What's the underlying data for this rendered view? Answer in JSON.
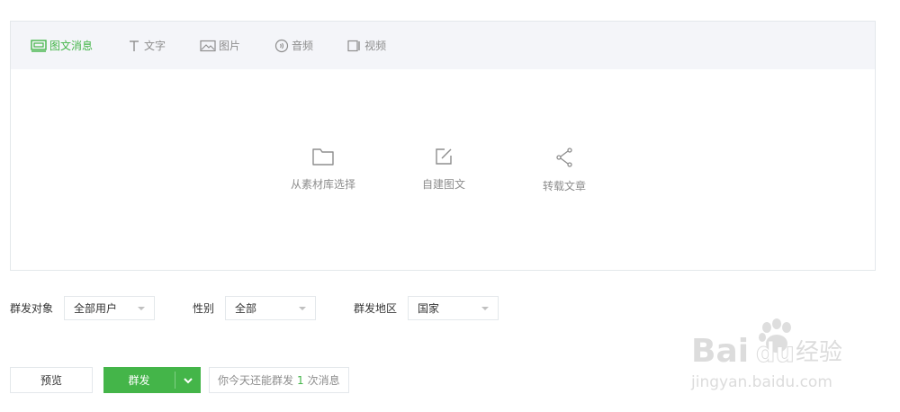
{
  "tabs": [
    {
      "label": "图文消息",
      "icon": "news-icon",
      "active": true
    },
    {
      "label": "文字",
      "icon": "text-icon",
      "active": false
    },
    {
      "label": "图片",
      "icon": "image-icon",
      "active": false
    },
    {
      "label": "音频",
      "icon": "audio-icon",
      "active": false
    },
    {
      "label": "视频",
      "icon": "video-icon",
      "active": false
    }
  ],
  "actions": [
    {
      "label": "从素材库选择",
      "icon": "folder-icon"
    },
    {
      "label": "自建图文",
      "icon": "edit-icon"
    },
    {
      "label": "转载文章",
      "icon": "share-icon"
    }
  ],
  "filters": {
    "target_label": "群发对象",
    "target_value": "全部用户",
    "gender_label": "性别",
    "gender_value": "全部",
    "region_label": "群发地区",
    "region_value": "国家"
  },
  "buttons": {
    "preview": "预览",
    "send": "群发"
  },
  "quota": {
    "prefix": "你今天还能群发",
    "count": "1",
    "suffix": "次消息"
  },
  "watermark": {
    "brand": "Bai",
    "paw": "du",
    "suffix": "经验",
    "url": "jingyan.baidu.com"
  },
  "colors": {
    "accent": "#44b549",
    "muted": "#8d8d8d",
    "border": "#e4e8eb",
    "tabbar_bg": "#f4f5f9"
  }
}
